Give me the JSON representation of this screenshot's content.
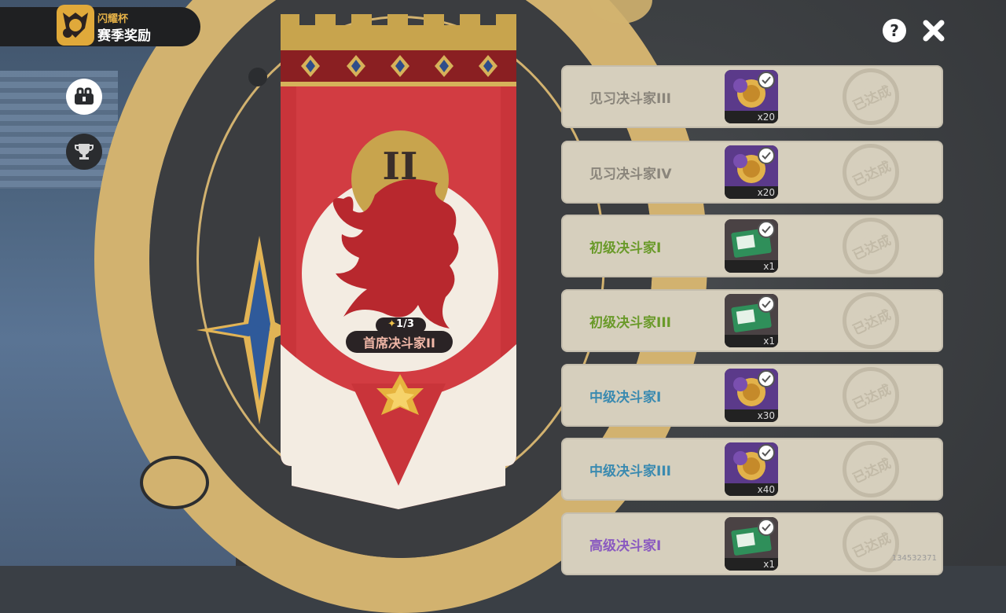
{
  "header": {
    "event_name": "闪耀杯",
    "page_title": "赛季奖励"
  },
  "side_tabs": [
    {
      "icon": "rewards-icon",
      "active": true
    },
    {
      "icon": "trophy-icon",
      "active": false
    }
  ],
  "top_buttons": {
    "help_icon": "question-icon",
    "close_icon": "close-icon"
  },
  "banner": {
    "tier_numeral": "II",
    "progress": "1/3",
    "rank_name": "首席决斗家II"
  },
  "rewards": [
    {
      "tier": "见习决斗家III",
      "tier_color": "#8a857b",
      "item": "coin-medal",
      "qty": "x20",
      "status": "已达成"
    },
    {
      "tier": "见习决斗家IV",
      "tier_color": "#8a857b",
      "item": "coin-medal",
      "qty": "x20",
      "status": "已达成"
    },
    {
      "tier": "初级决斗家I",
      "tier_color": "#6a9a2a",
      "item": "ticket",
      "qty": "x1",
      "status": "已达成"
    },
    {
      "tier": "初级决斗家III",
      "tier_color": "#6a9a2a",
      "item": "ticket",
      "qty": "x1",
      "status": "已达成"
    },
    {
      "tier": "中级决斗家I",
      "tier_color": "#3a8ab0",
      "item": "coin-medal",
      "qty": "x30",
      "status": "已达成"
    },
    {
      "tier": "中级决斗家III",
      "tier_color": "#3a8ab0",
      "item": "coin-medal",
      "qty": "x40",
      "status": "已达成"
    },
    {
      "tier": "高级决斗家I",
      "tier_color": "#8a5ac0",
      "item": "ticket",
      "qty": "x1",
      "status": "已达成"
    }
  ],
  "uid": "134532371"
}
